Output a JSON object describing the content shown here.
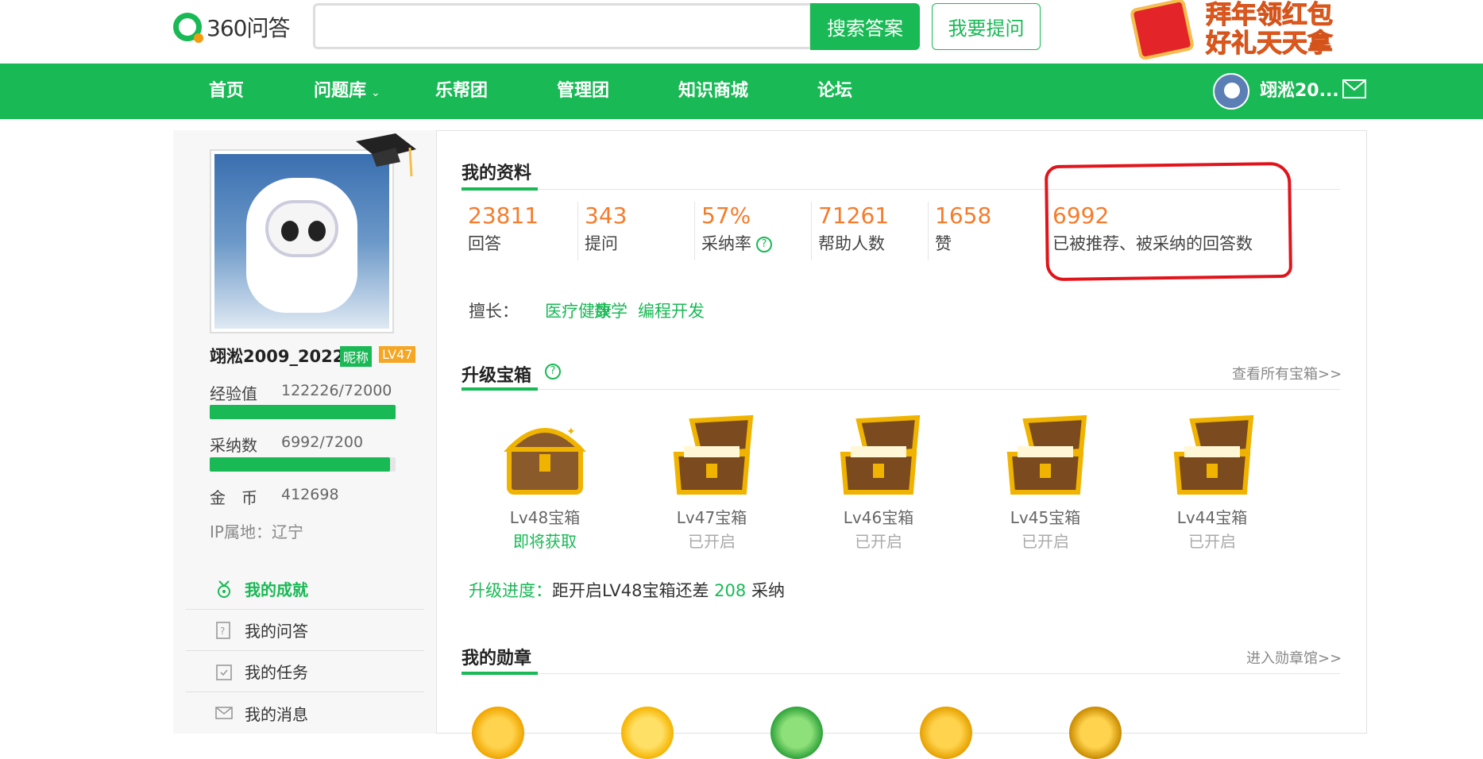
{
  "header": {
    "logo_text": "360问答",
    "search_placeholder": "",
    "search_button": "搜索答案",
    "ask_button": "我要提问",
    "promo_line1": "拜年领红包",
    "promo_line2": "好礼天天拿"
  },
  "nav": {
    "items": [
      "首页",
      "问题库",
      "乐帮团",
      "管理团",
      "知识商城",
      "论坛"
    ],
    "username": "翊淞20..."
  },
  "profile": {
    "name": "翊淞2009_2022",
    "nick_badge": "昵称",
    "level_badge": "LV47",
    "exp_label": "经验值",
    "exp_value": "122226/72000",
    "exp_progress": 1.0,
    "adopt_label": "采纳数",
    "adopt_value": "6992/7200",
    "adopt_progress": 0.971,
    "coin_label": "金　币",
    "coin_value": "412698",
    "ip_label": "IP属地：辽宁"
  },
  "menu": [
    {
      "label": "我的成就",
      "icon": "medal-icon",
      "active": true
    },
    {
      "label": "我的问答",
      "icon": "qa-icon",
      "active": false
    },
    {
      "label": "我的任务",
      "icon": "calendar-icon",
      "active": false
    },
    {
      "label": "我的消息",
      "icon": "mail-icon",
      "active": false
    }
  ],
  "my_info": {
    "title": "我的资料",
    "stats": [
      {
        "num": "23811",
        "desc": "回答"
      },
      {
        "num": "343",
        "desc": "提问"
      },
      {
        "num": "57%",
        "desc": "采纳率"
      },
      {
        "num": "71261",
        "desc": "帮助人数"
      },
      {
        "num": "1658",
        "desc": "赞"
      },
      {
        "num": "6992",
        "desc": "已被推荐、被采纳的回答数"
      }
    ],
    "skill_label": "擅长：",
    "skills": [
      "医疗健康",
      "数学",
      "编程开发"
    ]
  },
  "chests": {
    "title": "升级宝箱",
    "view_all": "查看所有宝箱>>",
    "items": [
      {
        "name": "Lv48宝箱",
        "status": "即将获取",
        "open": false
      },
      {
        "name": "Lv47宝箱",
        "status": "已开启",
        "open": true
      },
      {
        "name": "Lv46宝箱",
        "status": "已开启",
        "open": true
      },
      {
        "name": "Lv45宝箱",
        "status": "已开启",
        "open": true
      },
      {
        "name": "Lv44宝箱",
        "status": "已开启",
        "open": true
      }
    ],
    "progress_prefix": "升级进度：",
    "progress_text": "距开启LV48宝箱还差",
    "progress_num": "208",
    "progress_suffix": "采纳"
  },
  "medals": {
    "title": "我的勋章",
    "view_all": "进入勋章馆>>"
  },
  "colors": {
    "brand_green": "#19b955",
    "number_orange": "#f57c2b",
    "annotation_red": "#e1141b"
  }
}
